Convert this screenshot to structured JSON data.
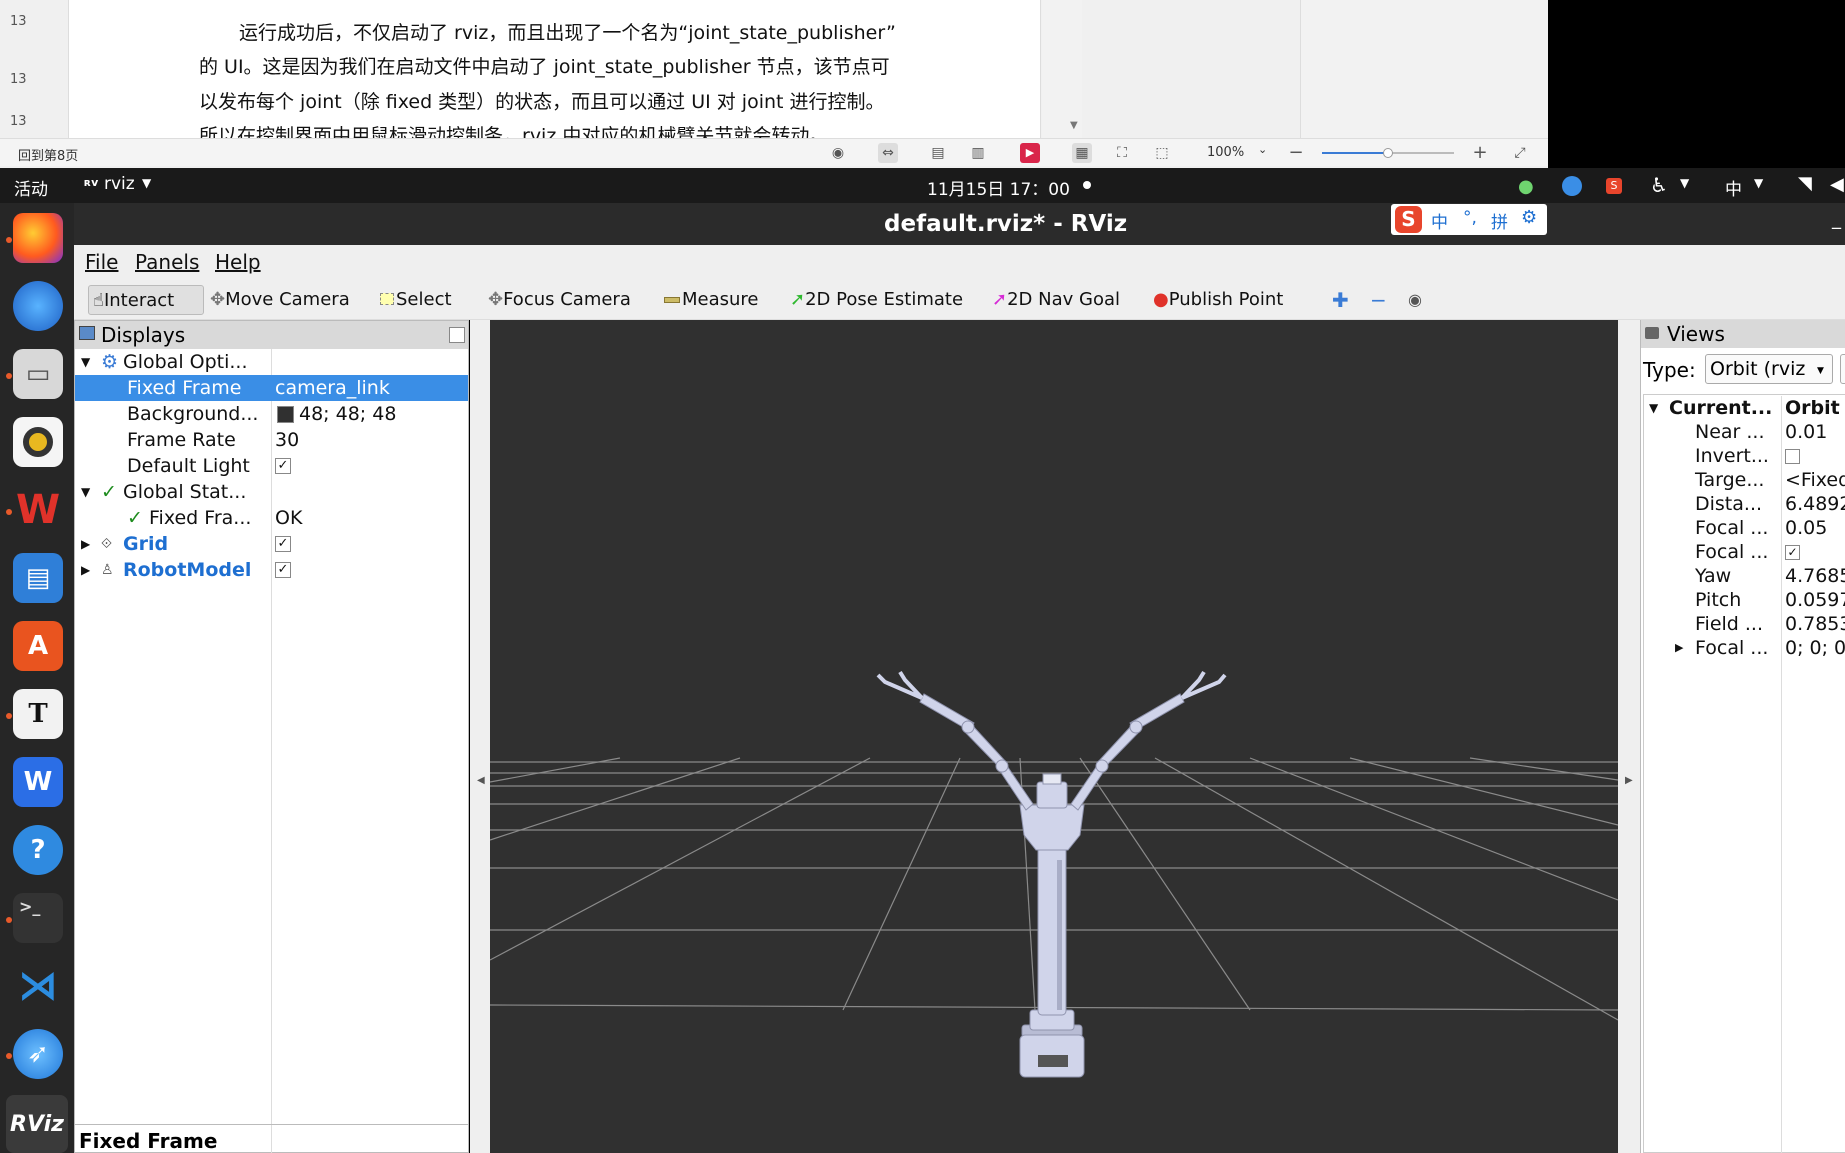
{
  "doc_viewer": {
    "line_numbers": [
      "13",
      "13",
      "13"
    ],
    "lines": [
      "运行成功后，不仅启动了 rviz，而且出现了一个名为“joint_state_publisher”",
      "的 UI。这是因为我们在启动文件中启动了 joint_state_publisher 节点，该节点可",
      "以发布每个 joint（除 fixed 类型）的状态，而且可以通过 UI 对 joint 进行控制。",
      "所以在控制界面中用鼠标滑动控制条，rviz 中对应的机械臂关节就会转动。"
    ],
    "back_to_page": "回到第8页",
    "zoom": "100%",
    "zoom_slider_value": 0.5
  },
  "topbar": {
    "activities": "活动",
    "app_name": "rviz",
    "clock": "11月15日 17：00",
    "input_method": "中"
  },
  "ime_toolbar": {
    "logo": "S",
    "items": [
      "中",
      "°,",
      "拼"
    ]
  },
  "window": {
    "title": "default.rviz* - RViz"
  },
  "menu": {
    "items": [
      "File",
      "Panels",
      "Help"
    ]
  },
  "toolbar": {
    "tools": [
      "Interact",
      "Move Camera",
      "Select",
      "Focus Camera",
      "Measure",
      "2D Pose Estimate",
      "2D Nav Goal",
      "Publish Point"
    ]
  },
  "displays": {
    "title": "Displays",
    "rows": [
      {
        "name": "Global Opti...",
        "value": ""
      },
      {
        "name": "Fixed Frame",
        "value": "camera_link"
      },
      {
        "name": "Background...",
        "value": "48; 48; 48"
      },
      {
        "name": "Frame Rate",
        "value": "30"
      },
      {
        "name": "Default Light",
        "value": "✓"
      },
      {
        "name": "Global Stat...",
        "value": ""
      },
      {
        "name": "Fixed Fra...",
        "value": "OK"
      },
      {
        "name": "Grid",
        "value": "✓"
      },
      {
        "name": "RobotModel",
        "value": "✓"
      }
    ],
    "footer": "Fixed Frame",
    "background_color": "#303030"
  },
  "views": {
    "title": "Views",
    "type_label": "Type:",
    "type_value": "Orbit (rviz",
    "rows": [
      {
        "name": "Current...",
        "value": "Orbit"
      },
      {
        "name": "Near ...",
        "value": "0.01"
      },
      {
        "name": "Invert...",
        "value": ""
      },
      {
        "name": "Targe...",
        "value": "<Fixed"
      },
      {
        "name": "Dista...",
        "value": "6.4892"
      },
      {
        "name": "Focal ...",
        "value": "0.05"
      },
      {
        "name": "Focal ...",
        "value": "✓"
      },
      {
        "name": "Yaw",
        "value": "4.7685"
      },
      {
        "name": "Pitch",
        "value": "0.0597"
      },
      {
        "name": "Field ...",
        "value": "0.7853"
      },
      {
        "name": "Focal ...",
        "value": "0; 0; 0"
      }
    ]
  },
  "colors": {
    "selection": "#3a8ee6",
    "robot": "#d0d4ea",
    "accent_link": "#1e6fd1"
  }
}
